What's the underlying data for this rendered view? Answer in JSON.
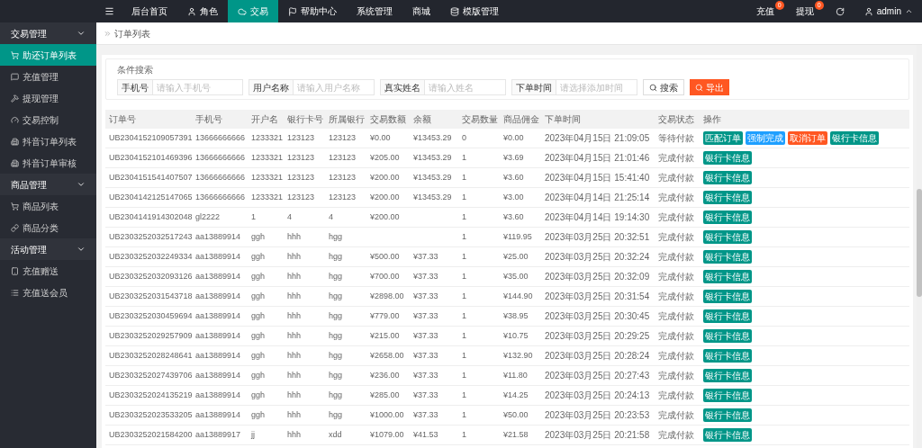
{
  "topbar": {
    "nav": [
      {
        "label": "后台首页",
        "selected": false
      },
      {
        "label": "角色",
        "selected": false
      },
      {
        "label": "交易",
        "selected": true
      },
      {
        "label": "帮助中心",
        "selected": false
      },
      {
        "label": "系统管理",
        "selected": false
      },
      {
        "label": "商城",
        "selected": false
      },
      {
        "label": "模版管理",
        "selected": false
      }
    ],
    "right": [
      {
        "label": "充值",
        "badge": "0"
      },
      {
        "label": "提现",
        "badge": "0"
      }
    ],
    "user": "admin"
  },
  "sidebar": {
    "groups": [
      {
        "label": "交易管理",
        "expanded": true,
        "items": [
          {
            "label": "助还订单列表",
            "selected": true
          },
          {
            "label": "充值管理",
            "selected": false
          },
          {
            "label": "提现管理",
            "selected": false
          },
          {
            "label": "交易控制",
            "selected": false
          },
          {
            "label": "抖音订单列表",
            "selected": false
          },
          {
            "label": "抖音订单审核",
            "selected": false
          }
        ]
      },
      {
        "label": "商品管理",
        "expanded": true,
        "items": [
          {
            "label": "商品列表",
            "selected": false
          },
          {
            "label": "商品分类",
            "selected": false
          }
        ]
      },
      {
        "label": "活动管理",
        "expanded": true,
        "items": [
          {
            "label": "充值赠送",
            "selected": false
          },
          {
            "label": "充值送会员",
            "selected": false
          }
        ]
      }
    ]
  },
  "breadcrumb": "订单列表",
  "search": {
    "title": "条件搜索",
    "fields": [
      {
        "label": "手机号",
        "placeholder": "请输入手机号"
      },
      {
        "label": "用户名称",
        "placeholder": "请输入用户名称"
      },
      {
        "label": "真实姓名",
        "placeholder": "请输入姓名"
      },
      {
        "label": "下单时间",
        "placeholder": "请选择添加时间"
      }
    ],
    "search_button": "搜索",
    "export_button": "导出"
  },
  "table": {
    "columns": [
      "订单号",
      "手机号",
      "开户名",
      "银行卡号",
      "所属银行",
      "交易数额",
      "余额",
      "交易数量",
      "商品佣金",
      "下单时间",
      "交易状态",
      "操作"
    ],
    "rows": [
      {
        "order_no": "UB2304152109057391",
        "phone": "13666666666",
        "account_name": "1233321",
        "card_no": "123123",
        "bank": "123123",
        "amount": "¥0.00",
        "balance": "¥13453.29",
        "quantity": "0",
        "commission": "¥0.00",
        "time": "2023年04月15日 21:09:05",
        "status": "等待付款",
        "actions": [
          {
            "label": "匹配订单",
            "color": "#009688"
          },
          {
            "label": "强制完成",
            "color": "#1e9fff"
          },
          {
            "label": "取消订单",
            "color": "#ff5722"
          },
          {
            "label": "银行卡信息",
            "color": "#009688"
          }
        ]
      },
      {
        "order_no": "UB2304152101469396",
        "phone": "13666666666",
        "account_name": "1233321",
        "card_no": "123123",
        "bank": "123123",
        "amount": "¥205.00",
        "balance": "¥13453.29",
        "quantity": "1",
        "commission": "¥3.69",
        "time": "2023年04月15日 21:01:46",
        "status": "完成付款",
        "actions": [
          {
            "label": "银行卡信息",
            "color": "#009688"
          }
        ]
      },
      {
        "order_no": "UB2304151541407507",
        "phone": "13666666666",
        "account_name": "1233321",
        "card_no": "123123",
        "bank": "123123",
        "amount": "¥200.00",
        "balance": "¥13453.29",
        "quantity": "1",
        "commission": "¥3.60",
        "time": "2023年04月15日 15:41:40",
        "status": "完成付款",
        "actions": [
          {
            "label": "银行卡信息",
            "color": "#009688"
          }
        ]
      },
      {
        "order_no": "UB2304142125147065",
        "phone": "13666666666",
        "account_name": "1233321",
        "card_no": "123123",
        "bank": "123123",
        "amount": "¥200.00",
        "balance": "¥13453.29",
        "quantity": "1",
        "commission": "¥3.00",
        "time": "2023年04月14日 21:25:14",
        "status": "完成付款",
        "actions": [
          {
            "label": "银行卡信息",
            "color": "#009688"
          }
        ]
      },
      {
        "order_no": "UB2304141914302048",
        "phone": "gl2222",
        "account_name": "1",
        "card_no": "4",
        "bank": "4",
        "amount": "¥200.00",
        "quantity": "1",
        "commission": "¥3.60",
        "time": "2023年04月14日 19:14:30",
        "status": "完成付款",
        "actions": [
          {
            "label": "银行卡信息",
            "color": "#009688"
          }
        ]
      },
      {
        "order_no": "UB2303252032517243",
        "phone": "aa13889914",
        "account_name": "ggh",
        "card_no": "hhh",
        "bank": "hgg",
        "quantity": "1",
        "commission": "¥119.95",
        "time": "2023年03月25日 20:32:51",
        "status": "完成付款",
        "actions": [
          {
            "label": "银行卡信息",
            "color": "#009688"
          }
        ]
      },
      {
        "order_no": "UB2303252032249334",
        "phone": "aa13889914",
        "account_name": "ggh",
        "card_no": "hhh",
        "bank": "hgg",
        "amount": "¥500.00",
        "balance": "¥37.33",
        "quantity": "1",
        "commission": "¥25.00",
        "time": "2023年03月25日 20:32:24",
        "status": "完成付款",
        "actions": [
          {
            "label": "银行卡信息",
            "color": "#009688"
          }
        ]
      },
      {
        "order_no": "UB2303252032093126",
        "phone": "aa13889914",
        "account_name": "ggh",
        "card_no": "hhh",
        "bank": "hgg",
        "amount": "¥700.00",
        "balance": "¥37.33",
        "quantity": "1",
        "commission": "¥35.00",
        "time": "2023年03月25日 20:32:09",
        "status": "完成付款",
        "actions": [
          {
            "label": "银行卡信息",
            "color": "#009688"
          }
        ]
      },
      {
        "order_no": "UB2303252031543718",
        "phone": "aa13889914",
        "account_name": "ggh",
        "card_no": "hhh",
        "bank": "hgg",
        "amount": "¥2898.00",
        "balance": "¥37.33",
        "quantity": "1",
        "commission": "¥144.90",
        "time": "2023年03月25日 20:31:54",
        "status": "完成付款",
        "actions": [
          {
            "label": "银行卡信息",
            "color": "#009688"
          }
        ]
      },
      {
        "order_no": "UB2303252030459694",
        "phone": "aa13889914",
        "account_name": "ggh",
        "card_no": "hhh",
        "bank": "hgg",
        "amount": "¥779.00",
        "balance": "¥37.33",
        "quantity": "1",
        "commission": "¥38.95",
        "time": "2023年03月25日 20:30:45",
        "status": "完成付款",
        "actions": [
          {
            "label": "银行卡信息",
            "color": "#009688"
          }
        ]
      },
      {
        "order_no": "UB2303252029257909",
        "phone": "aa13889914",
        "account_name": "ggh",
        "card_no": "hhh",
        "bank": "hgg",
        "amount": "¥215.00",
        "balance": "¥37.33",
        "quantity": "1",
        "commission": "¥10.75",
        "time": "2023年03月25日 20:29:25",
        "status": "完成付款",
        "actions": [
          {
            "label": "银行卡信息",
            "color": "#009688"
          }
        ]
      },
      {
        "order_no": "UB2303252028248641",
        "phone": "aa13889914",
        "account_name": "ggh",
        "card_no": "hhh",
        "bank": "hgg",
        "amount": "¥2658.00",
        "balance": "¥37.33",
        "quantity": "1",
        "commission": "¥132.90",
        "time": "2023年03月25日 20:28:24",
        "status": "完成付款",
        "actions": [
          {
            "label": "银行卡信息",
            "color": "#009688"
          }
        ]
      },
      {
        "order_no": "UB2303252027439706",
        "phone": "aa13889914",
        "account_name": "ggh",
        "card_no": "hhh",
        "bank": "hgg",
        "amount": "¥236.00",
        "balance": "¥37.33",
        "quantity": "1",
        "commission": "¥11.80",
        "time": "2023年03月25日 20:27:43",
        "status": "完成付款",
        "actions": [
          {
            "label": "银行卡信息",
            "color": "#009688"
          }
        ]
      },
      {
        "order_no": "UB2303252024135219",
        "phone": "aa13889914",
        "account_name": "ggh",
        "card_no": "hhh",
        "bank": "hgg",
        "amount": "¥285.00",
        "balance": "¥37.33",
        "quantity": "1",
        "commission": "¥14.25",
        "time": "2023年03月25日 20:24:13",
        "status": "完成付款",
        "actions": [
          {
            "label": "银行卡信息",
            "color": "#009688"
          }
        ]
      },
      {
        "order_no": "UB2303252023533205",
        "phone": "aa13889914",
        "account_name": "ggh",
        "card_no": "hhh",
        "bank": "hgg",
        "amount": "¥1000.00",
        "balance": "¥37.33",
        "quantity": "1",
        "commission": "¥50.00",
        "time": "2023年03月25日 20:23:53",
        "status": "完成付款",
        "actions": [
          {
            "label": "银行卡信息",
            "color": "#009688"
          }
        ]
      },
      {
        "order_no": "UB2303252021584200",
        "phone": "aa13889917",
        "account_name": "jj",
        "card_no": "hhh",
        "bank": "xdd",
        "amount": "¥1079.00",
        "balance": "¥41.53",
        "quantity": "1",
        "commission": "¥21.58",
        "time": "2023年03月25日 20:21:58",
        "status": "完成付款",
        "actions": [
          {
            "label": "银行卡信息",
            "color": "#009688"
          }
        ]
      }
    ]
  }
}
